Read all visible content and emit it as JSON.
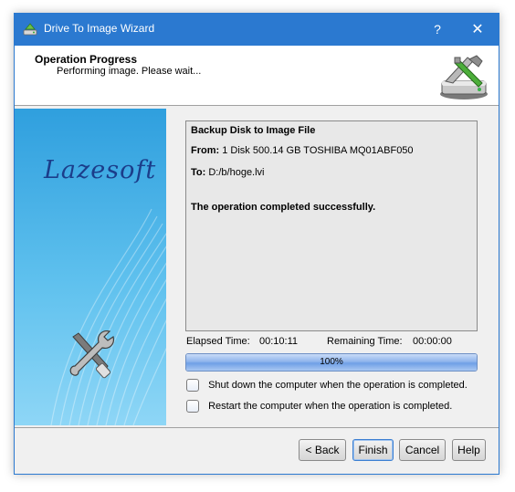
{
  "window": {
    "title": "Drive To Image Wizard",
    "help_symbol": "?",
    "close_symbol": "✕",
    "accent_color": "#2b79d0"
  },
  "header": {
    "title": "Operation Progress",
    "subtitle": "Performing image. Please wait...",
    "icon": "disk-tools-icon"
  },
  "banner": {
    "brand": "Lazesoft",
    "icon": "wrench-screwdriver-icon"
  },
  "log": {
    "title": "Backup Disk to Image File",
    "from_label": "From:",
    "from_value": "1 Disk 500.14 GB TOSHIBA MQ01ABF050",
    "to_label": "To:",
    "to_value": "D:/b/hoge.lvi",
    "result": "The operation completed successfully."
  },
  "timing": {
    "elapsed_label": "Elapsed Time:",
    "elapsed_value": "00:10:11",
    "remaining_label": "Remaining Time:",
    "remaining_value": "00:00:00"
  },
  "progress": {
    "percent": 100,
    "label": "100%"
  },
  "options": {
    "shutdown_label": "Shut down the computer when the operation is completed.",
    "shutdown_checked": false,
    "restart_label": "Restart the computer when the operation is completed.",
    "restart_checked": false
  },
  "buttons": {
    "back": "< Back",
    "finish": "Finish",
    "cancel": "Cancel",
    "help": "Help"
  }
}
